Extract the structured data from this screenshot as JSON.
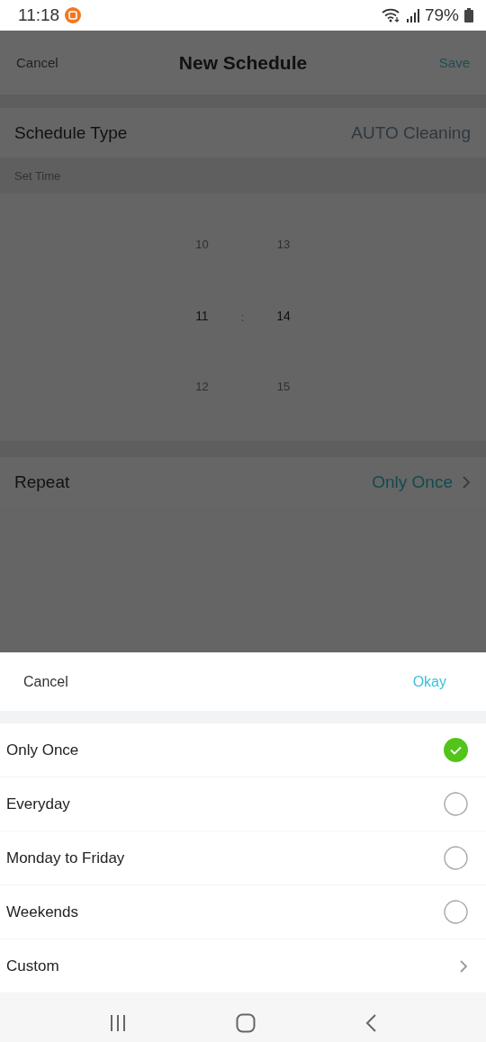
{
  "status_bar": {
    "time": "11:18",
    "battery": "79%"
  },
  "header": {
    "cancel": "Cancel",
    "title": "New Schedule",
    "save": "Save"
  },
  "schedule_type": {
    "label": "Schedule Type",
    "value": "AUTO Cleaning"
  },
  "set_time": {
    "label": "Set Time",
    "separator": ":",
    "hours": [
      {
        "value": "10",
        "selected": false
      },
      {
        "value": "11",
        "selected": true
      },
      {
        "value": "12",
        "selected": false
      }
    ],
    "minutes": [
      {
        "value": "13",
        "selected": false
      },
      {
        "value": "14",
        "selected": true
      },
      {
        "value": "15",
        "selected": false
      }
    ]
  },
  "repeat": {
    "label": "Repeat",
    "value": "Only Once"
  },
  "sheet": {
    "cancel": "Cancel",
    "okay": "Okay",
    "options": [
      {
        "kind": "radio",
        "label": "Only Once",
        "selected": true
      },
      {
        "kind": "radio",
        "label": "Everyday",
        "selected": false
      },
      {
        "kind": "radio",
        "label": "Monday to Friday",
        "selected": false
      },
      {
        "kind": "radio",
        "label": "Weekends",
        "selected": false
      },
      {
        "kind": "link",
        "label": "Custom"
      }
    ]
  }
}
